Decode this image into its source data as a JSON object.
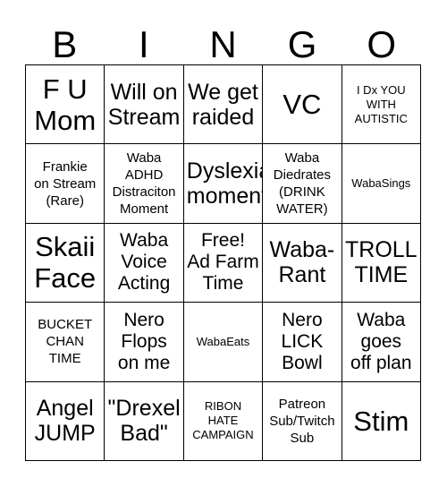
{
  "card": {
    "title": "BINGO",
    "header_letters": [
      "B",
      "I",
      "N",
      "G",
      "O"
    ],
    "rows": 5,
    "columns": 5,
    "colors": {
      "background": "#ffffff",
      "text": "#000000",
      "grid_line": "#000000"
    },
    "cells": [
      {
        "text": "F U\nMom",
        "size": "xl"
      },
      {
        "text": "Will on\nStream",
        "size": "l"
      },
      {
        "text": "We get\nraided",
        "size": "l"
      },
      {
        "text": "VC",
        "size": "xl"
      },
      {
        "text": "I Dx YOU\nWITH\nAUTISTIC",
        "size": "xs"
      },
      {
        "text": "Frankie\non Stream\n(Rare)",
        "size": "s"
      },
      {
        "text": "Waba\nADHD\nDistraciton\nMoment",
        "size": "s"
      },
      {
        "text": "Dyslexia\nmoment",
        "size": "l"
      },
      {
        "text": "Waba\nDiedrates\n(DRINK\nWATER)",
        "size": "s"
      },
      {
        "text": "WabaSings",
        "size": "xs"
      },
      {
        "text": "Skaii\nFace",
        "size": "xl"
      },
      {
        "text": "Waba\nVoice\nActing",
        "size": "m"
      },
      {
        "text": "Free!\nAd Farm\nTime",
        "size": "m"
      },
      {
        "text": "Waba-\nRant",
        "size": "l"
      },
      {
        "text": "TROLL\nTIME",
        "size": "l"
      },
      {
        "text": "BUCKET\nCHAN\nTIME",
        "size": "s"
      },
      {
        "text": "Nero\nFlops\non me",
        "size": "m"
      },
      {
        "text": "WabaEats",
        "size": "xs"
      },
      {
        "text": "Nero\nLICK\nBowl",
        "size": "m"
      },
      {
        "text": "Waba\ngoes\noff plan",
        "size": "m"
      },
      {
        "text": "Angel\nJUMP",
        "size": "l"
      },
      {
        "text": "\"Drexel\nBad\"",
        "size": "l"
      },
      {
        "text": "RIBON\nHATE\nCAMPAIGN",
        "size": "xs"
      },
      {
        "text": "Patreon\nSub/Twitch\nSub",
        "size": "s"
      },
      {
        "text": "Stim",
        "size": "xl"
      }
    ]
  }
}
